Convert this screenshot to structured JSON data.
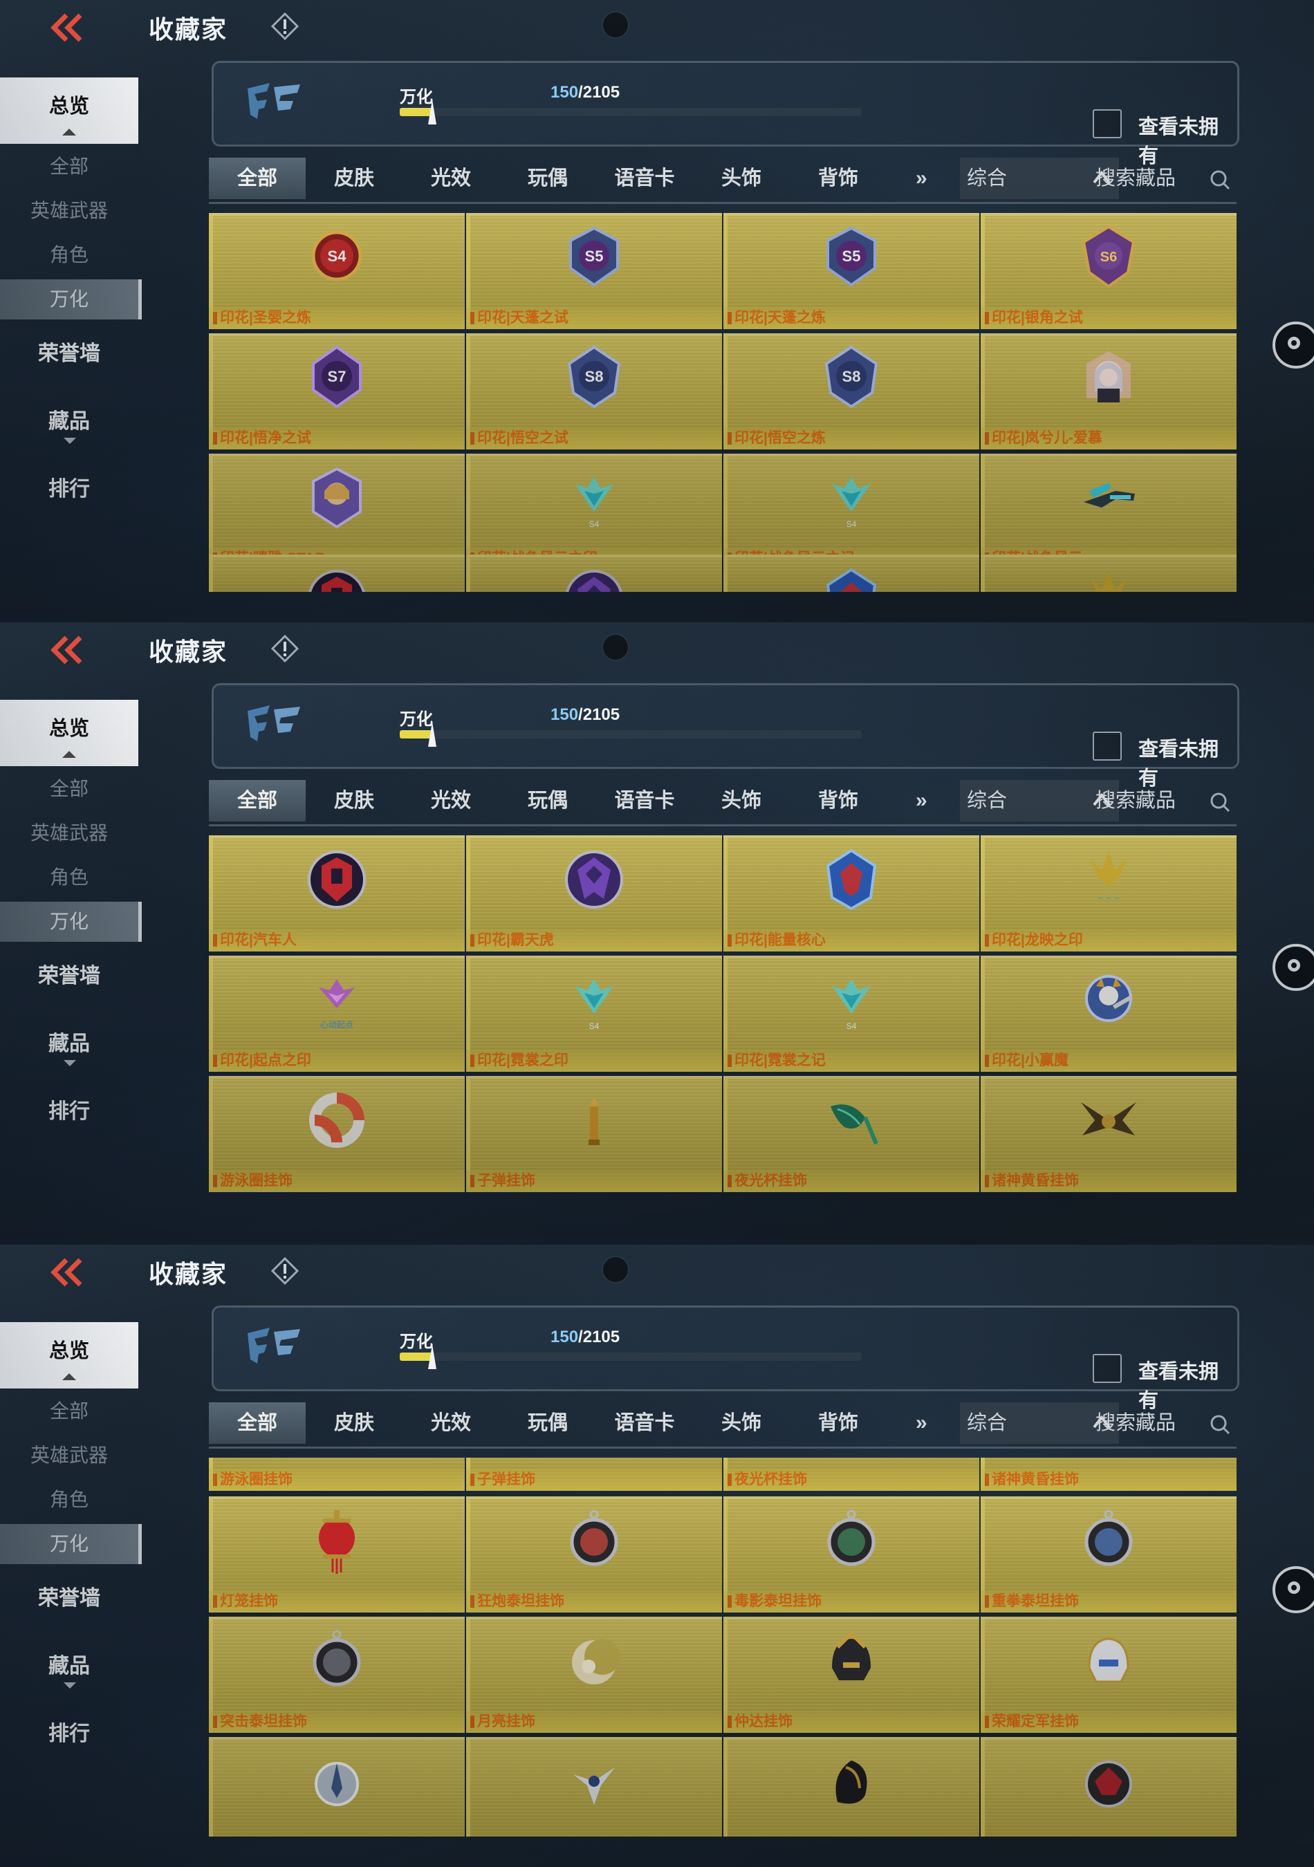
{
  "header": {
    "title": "收藏家"
  },
  "progress": {
    "label": "万化",
    "current": "150",
    "total": "/2105",
    "fill_fraction": 0.071,
    "checkbox_label": "查看未拥有"
  },
  "sidebar": {
    "main_label": "总览",
    "sub_items": [
      "全部",
      "英雄武器",
      "角色",
      "万化"
    ],
    "active_sub_index": 3,
    "big_items": [
      "荣誉墙",
      "藏品",
      "排行"
    ]
  },
  "tabs": [
    "全部",
    "皮肤",
    "光效",
    "玩偶",
    "语音卡",
    "头饰",
    "背饰"
  ],
  "tab_more": "»",
  "sort_label": "综合",
  "search_label": "搜索藏品",
  "screens": [
    {
      "rows": [
        [
          {
            "name": "印花|圣婴之炼",
            "icon": "badge-s4"
          },
          {
            "name": "印花|天蓬之试",
            "icon": "badge-s5"
          },
          {
            "name": "印花|天蓬之炼",
            "icon": "badge-s5"
          },
          {
            "name": "印花|银角之试",
            "icon": "badge-s6"
          }
        ],
        [
          {
            "name": "印花|悟净之试",
            "icon": "badge-s7"
          },
          {
            "name": "印花|悟空之试",
            "icon": "badge-s8"
          },
          {
            "name": "印花|悟空之炼",
            "icon": "badge-s8"
          },
          {
            "name": "印花|岚兮儿-爱慕",
            "icon": "anime-girl"
          }
        ],
        [
          {
            "name": "印花|晴雅-STAR",
            "icon": "hero-portrait"
          },
          {
            "name": "印花|战争风云之印",
            "icon": "wing-emblem"
          },
          {
            "name": "印花|战争风云之记",
            "icon": "wing-emblem"
          },
          {
            "name": "印花|战争风云",
            "icon": "gun-emblem"
          }
        ],
        [
          {
            "name": "",
            "icon": "autobot"
          },
          {
            "name": "",
            "icon": "decepticon"
          },
          {
            "name": "",
            "icon": "energy-core"
          },
          {
            "name": "",
            "icon": "dragon-mark"
          }
        ]
      ]
    },
    {
      "rows": [
        [
          {
            "name": "印花|汽车人",
            "icon": "autobot"
          },
          {
            "name": "印花|霸天虎",
            "icon": "decepticon"
          },
          {
            "name": "印花|能量核心",
            "icon": "energy-core"
          },
          {
            "name": "印花|龙映之印",
            "icon": "dragon-mark"
          }
        ],
        [
          {
            "name": "印花|起点之印",
            "icon": "heart-wing"
          },
          {
            "name": "印花|霓裳之印",
            "icon": "wing-emblem"
          },
          {
            "name": "印花|霓裳之记",
            "icon": "wing-emblem"
          },
          {
            "name": "印花|小赢魔",
            "icon": "imp"
          }
        ],
        [
          {
            "name": "游泳圈挂饰",
            "icon": "swim-ring"
          },
          {
            "name": "子弹挂饰",
            "icon": "bullet"
          },
          {
            "name": "夜光杯挂饰",
            "icon": "leaf-cup"
          },
          {
            "name": "诸神黄昏挂饰",
            "icon": "dark-wing"
          }
        ]
      ]
    },
    {
      "rows": [
        [
          {
            "name": "游泳圈挂饰",
            "icon": "none"
          },
          {
            "name": "子弹挂饰",
            "icon": "none"
          },
          {
            "name": "夜光杯挂饰",
            "icon": "none"
          },
          {
            "name": "诸神黄昏挂饰",
            "icon": "none"
          }
        ],
        [
          {
            "name": "灯笼挂饰",
            "icon": "lantern"
          },
          {
            "name": "狂炮泰坦挂饰",
            "icon": "titan-red"
          },
          {
            "name": "毒影泰坦挂饰",
            "icon": "titan-green"
          },
          {
            "name": "重拳泰坦挂饰",
            "icon": "titan-blue"
          }
        ],
        [
          {
            "name": "突击泰坦挂饰",
            "icon": "titan-gray"
          },
          {
            "name": "月亮挂饰",
            "icon": "moon"
          },
          {
            "name": "仲达挂饰",
            "icon": "helmet-gold"
          },
          {
            "name": "荣耀定军挂饰",
            "icon": "helmet-white"
          }
        ],
        [
          {
            "name": "",
            "icon": "ship"
          },
          {
            "name": "",
            "icon": "bird"
          },
          {
            "name": "",
            "icon": "horn-dark"
          },
          {
            "name": "",
            "icon": "wolf-red"
          }
        ]
      ]
    }
  ],
  "colors": {
    "card_yellow": "#c9b851",
    "label_orange": "#e46f14",
    "progress_yellow": "#f1e24a",
    "accent_blue": "#8fd2ff"
  }
}
